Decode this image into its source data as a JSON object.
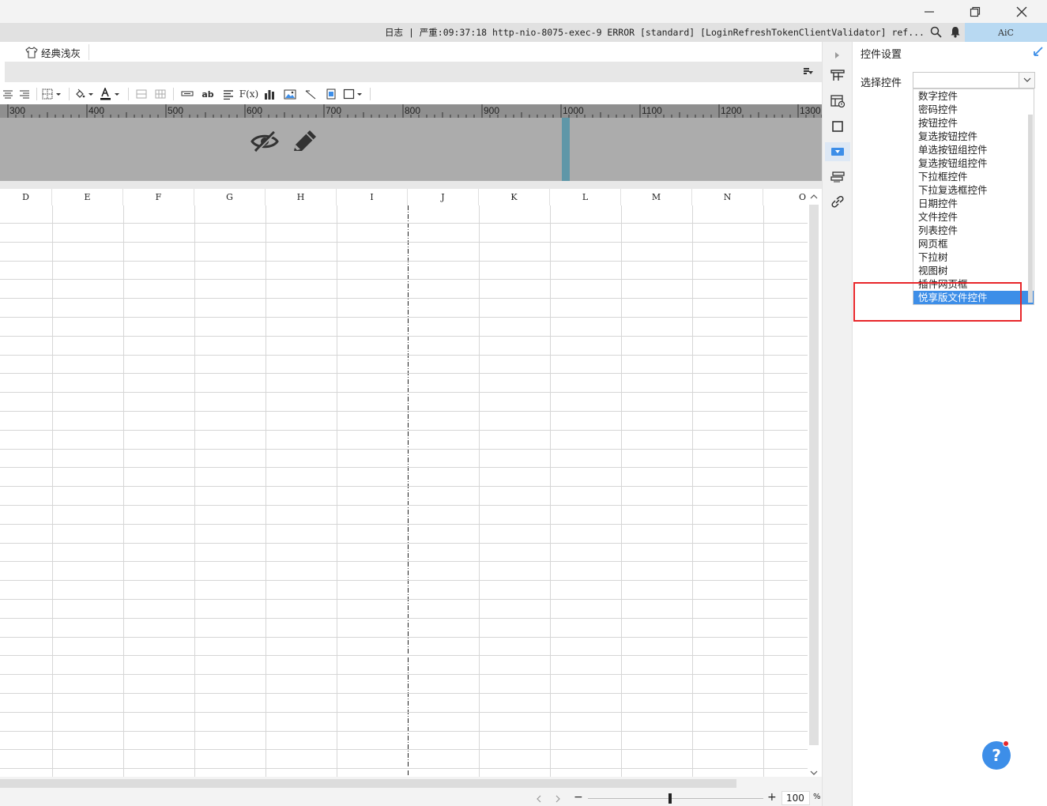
{
  "logbar": {
    "text": "日志 | 严重:09:37:18 http-nio-8075-exec-9 ERROR [standard] [LoginRefreshTokenClientValidator] ref...",
    "user": "AiC"
  },
  "theme": {
    "label": "经典浅灰"
  },
  "ruler": {
    "labels": [
      "300",
      "400",
      "500",
      "600",
      "700",
      "800",
      "900",
      "1000",
      "1100",
      "1200",
      "1300"
    ]
  },
  "columns": [
    "D",
    "E",
    "F",
    "G",
    "H",
    "I",
    "J",
    "K",
    "L",
    "M",
    "N",
    "O"
  ],
  "panel": {
    "title": "控件设置",
    "select_label": "选择控件",
    "select_value": "",
    "options": [
      "数字控件",
      "密码控件",
      "按钮控件",
      "复选按钮控件",
      "单选按钮组控件",
      "复选按钮组控件",
      "下拉框控件",
      "下拉复选框控件",
      "日期控件",
      "文件控件",
      "列表控件",
      "网页框",
      "下拉树",
      "视图树",
      "插件网页框",
      "悦享版文件控件"
    ],
    "selected_option": "悦享版文件控件"
  },
  "zoom": {
    "value": "100",
    "unit": "%",
    "minus": "−",
    "plus": "+"
  },
  "help": {
    "label": "?"
  },
  "colors": {
    "accent": "#3d8ee8",
    "highlight_box": "#e8262a"
  }
}
